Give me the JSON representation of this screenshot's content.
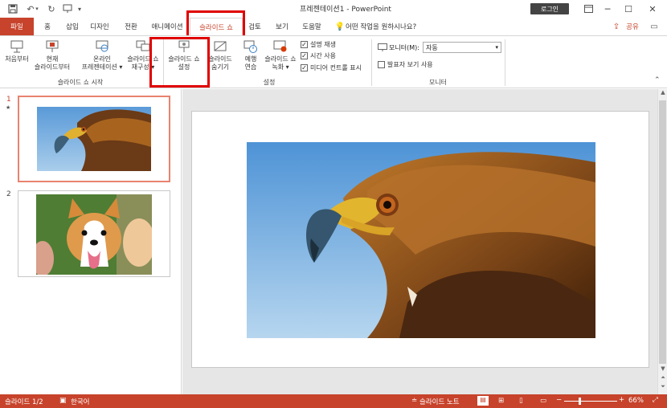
{
  "title": "프레젠테이션1 - PowerPoint",
  "login_label": "로그인",
  "tabs": {
    "file": "파일",
    "home": "홈",
    "insert": "삽입",
    "design": "디자인",
    "transitions": "전환",
    "animations": "애니메이션",
    "slideshow": "슬라이드 쇼",
    "review": "검토",
    "view": "보기",
    "help": "도움말",
    "tellme": "어떤 작업을 원하시나요?",
    "share": "공유"
  },
  "ribbon": {
    "start": {
      "from_beginning": "처음부터",
      "from_current_1": "현재",
      "from_current_2": "슬라이드부터",
      "online_1": "온라인",
      "online_2": "프레젠테이션",
      "custom_1": "슬라이드 쇼",
      "custom_2": "재구성",
      "group": "슬라이드 쇼 시작"
    },
    "setup": {
      "setup_1": "슬라이드 쇼",
      "setup_2": "설정",
      "hide_1": "슬라이드",
      "hide_2": "숨기기",
      "rehearse_1": "예행",
      "rehearse_2": "연습",
      "record_1": "슬라이드 쇼",
      "record_2": "녹화",
      "play_narrations": "설명 재생",
      "use_timings": "시간 사용",
      "show_media": "미디어 컨트롤 표시",
      "group": "설정"
    },
    "monitor": {
      "monitor_label": "모니터(M):",
      "monitor_value": "자동",
      "presenter_view": "발표자 보기 사용",
      "group": "모니터"
    }
  },
  "slides": [
    {
      "number": "1",
      "star": "★"
    },
    {
      "number": "2"
    }
  ],
  "status": {
    "slide_info": "슬라이드 1/2",
    "language": "한국어",
    "notes": "슬라이드 노트",
    "zoom": "66%"
  },
  "colors": {
    "accent": "#c7432b",
    "highlight": "#e00000"
  }
}
